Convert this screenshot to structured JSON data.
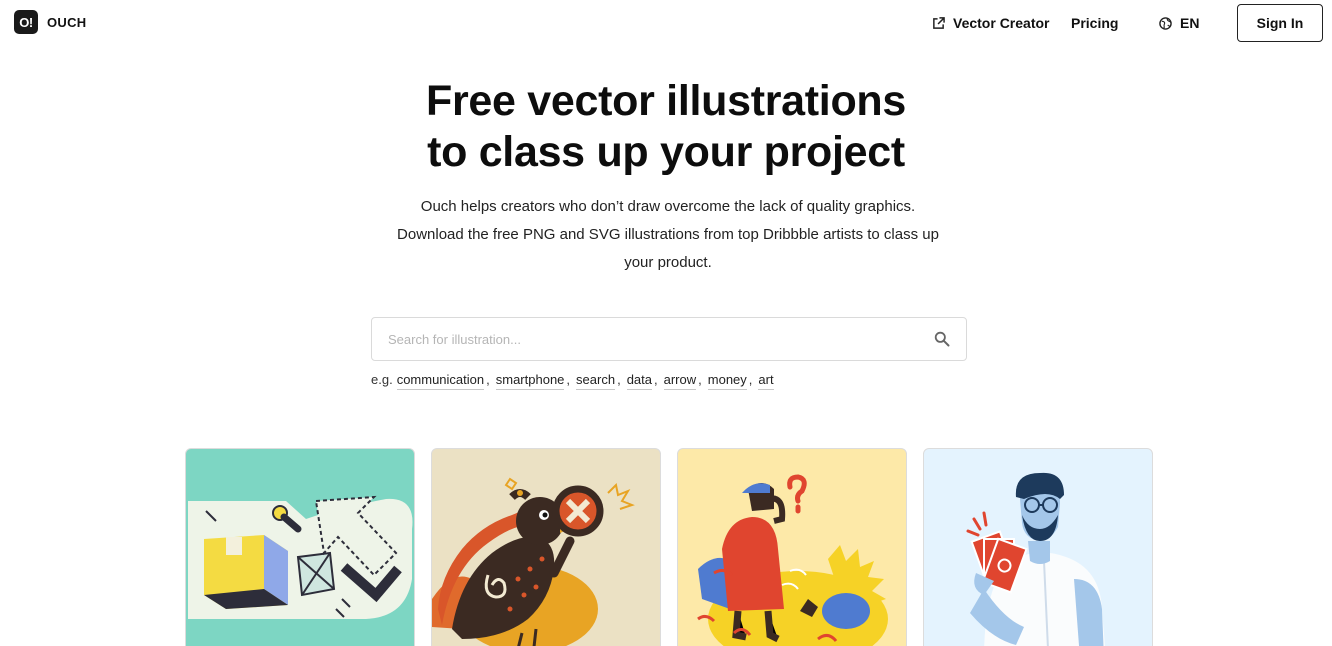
{
  "header": {
    "logo_badge": "O!",
    "logo_text": "OUCH",
    "nav": {
      "vector_creator": "Vector Creator",
      "pricing": "Pricing",
      "language": "EN"
    },
    "sign_in": "Sign In"
  },
  "hero": {
    "title_line1": "Free vector illustrations",
    "title_line2": "to class up your project",
    "subtitle_line1": "Ouch helps creators who don’t draw overcome the lack of quality graphics.",
    "subtitle_line2": "Download the free PNG and SVG illustrations from top Dribbble artists to class up",
    "subtitle_line3": "your product."
  },
  "search": {
    "placeholder": "Search for illustration...",
    "value": ""
  },
  "examples": {
    "prefix": "e.g.",
    "tags": [
      "communication",
      "smartphone",
      "search",
      "data",
      "arrow",
      "money",
      "art"
    ]
  },
  "icons": {
    "vector_creator": "external-link-icon",
    "language": "globe-icon",
    "search": "search-icon"
  },
  "colors": {
    "card1_bg": "#7dd6c3",
    "card2_bg": "#ebe1c4",
    "card3_bg": "#fde9a8",
    "card4_bg": "#e4f3fe"
  }
}
